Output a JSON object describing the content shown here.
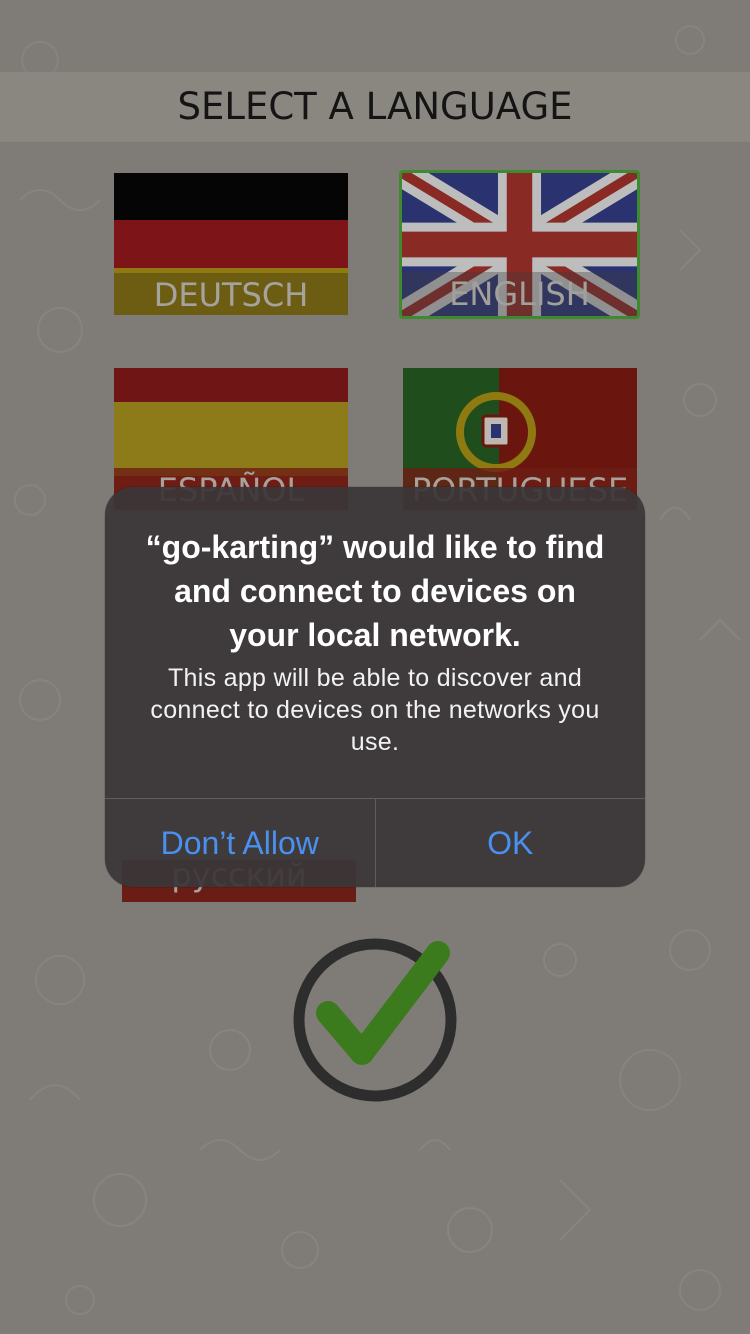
{
  "header": {
    "title": "SELECT A LANGUAGE"
  },
  "languages": [
    {
      "label": "DEUTSCH",
      "selected": false
    },
    {
      "label": "ENGLISH",
      "selected": true
    },
    {
      "label": "ESPAÑOL",
      "selected": false
    },
    {
      "label": "PORTUGUESE",
      "selected": false
    },
    {
      "label": "русский",
      "selected": false
    }
  ],
  "alert": {
    "title": "“go-karting” would like to find and connect to devices on your local network.",
    "message": "This app will be able to discover and connect to devices on the networks you use.",
    "deny_label": "Don’t Allow",
    "ok_label": "OK"
  },
  "colors": {
    "accent": "#4a90f0",
    "selection_border": "#3e8a2e",
    "confirm_check": "#3c7a1e"
  },
  "icons": {
    "confirm": "checkmark-circle-icon"
  }
}
